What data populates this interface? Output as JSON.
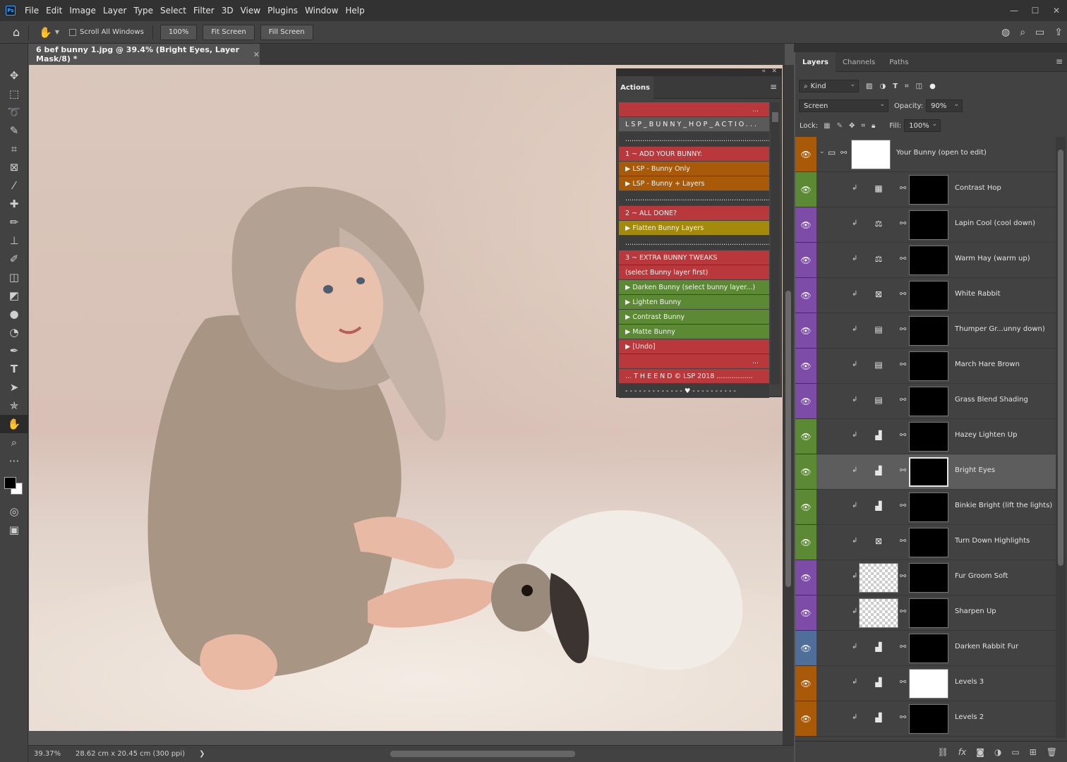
{
  "app": {
    "logo": "Ps",
    "menu": [
      "File",
      "Edit",
      "Image",
      "Layer",
      "Type",
      "Select",
      "Filter",
      "3D",
      "View",
      "Plugins",
      "Window",
      "Help"
    ],
    "window_controls": [
      "—",
      "☐",
      "✕"
    ]
  },
  "options_bar": {
    "scroll_all_windows": "Scroll All Windows",
    "zoom_value": "100%",
    "fit_screen": "Fit Screen",
    "fill_screen": "Fill Screen"
  },
  "document": {
    "tab_title": "6 bef bunny 1.jpg @ 39.4% (Bright Eyes, Layer Mask/8) *",
    "close": "✕"
  },
  "status": {
    "zoom": "39.37%",
    "doc_info": "28.62 cm x 20.45 cm (300 ppi)",
    "arrow": "❯"
  },
  "actions_panel": {
    "tab": "Actions",
    "items": [
      {
        "label": "...",
        "color": "red",
        "align": "right"
      },
      {
        "label": "LSP_BUNNY_HOP_ACTIO...",
        "color": "grey"
      },
      {
        "label": "........................................................................",
        "color": "dark"
      },
      {
        "label": "1 ~ ADD YOUR BUNNY:",
        "color": "red"
      },
      {
        "label": "▶  LSP - Bunny Only",
        "color": "orange"
      },
      {
        "label": "▶  LSP - Bunny + Layers",
        "color": "orange"
      },
      {
        "label": "........................................................................",
        "color": "dark"
      },
      {
        "label": "2 ~ ALL DONE?",
        "color": "red"
      },
      {
        "label": "▶  Flatten Bunny Layers",
        "color": "yellow"
      },
      {
        "label": "........................................................................",
        "color": "dark"
      },
      {
        "label": "3 ~ EXTRA BUNNY TWEAKS",
        "color": "red"
      },
      {
        "label": "(select Bunny layer first)",
        "color": "red"
      },
      {
        "label": "▶  Darken Bunny (select bunny layer...)",
        "color": "green"
      },
      {
        "label": "▶  Lighten Bunny",
        "color": "green"
      },
      {
        "label": "▶  Contrast Bunny",
        "color": "green"
      },
      {
        "label": "▶  Matte Bunny",
        "color": "green"
      },
      {
        "label": "▶  [Undo]",
        "color": "red"
      },
      {
        "label": "...",
        "color": "red",
        "align": "right"
      },
      {
        "label": "... T H E  E N D © LSP 2018 .................",
        "color": "red"
      },
      {
        "label": "- - - - - - - - - - - - - ♥ - - - - - - - - - -",
        "color": "dark"
      }
    ]
  },
  "layers_panel": {
    "tabs": [
      "Layers",
      "Channels",
      "Paths"
    ],
    "filter_kind": "Kind",
    "blend_mode": "Screen",
    "opacity_label": "Opacity:",
    "opacity_value": "90%",
    "lock_label": "Lock:",
    "fill_label": "Fill:",
    "fill_value": "100%",
    "layers": [
      {
        "name": "Your Bunny (open to edit)",
        "eye_color": "#a85a08",
        "type": "group",
        "adj_icon": ""
      },
      {
        "name": "Contrast Hop",
        "eye_color": "#5c8a34",
        "type": "adj",
        "adj_icon": "▦"
      },
      {
        "name": "Lapin Cool (cool down)",
        "eye_color": "#7c4ca6",
        "type": "adj",
        "adj_icon": "⚖"
      },
      {
        "name": "Warm Hay (warm up)",
        "eye_color": "#7c4ca6",
        "type": "adj",
        "adj_icon": "⚖"
      },
      {
        "name": "White Rabbit",
        "eye_color": "#7c4ca6",
        "type": "adj",
        "adj_icon": "⊠"
      },
      {
        "name": "Thumper Gr...unny down)",
        "eye_color": "#7c4ca6",
        "type": "adj",
        "adj_icon": "▤"
      },
      {
        "name": "March Hare Brown",
        "eye_color": "#7c4ca6",
        "type": "adj",
        "adj_icon": "▤"
      },
      {
        "name": "Grass Blend Shading",
        "eye_color": "#7c4ca6",
        "type": "adj",
        "adj_icon": "▤"
      },
      {
        "name": "Hazey Lighten Up",
        "eye_color": "#5c8a34",
        "type": "adj",
        "adj_icon": "▟"
      },
      {
        "name": "Bright Eyes",
        "eye_color": "#5c8a34",
        "type": "adj",
        "adj_icon": "▟"
      },
      {
        "name": "Binkie Bright (lift the lights)",
        "eye_color": "#5c8a34",
        "type": "adj",
        "adj_icon": "▟"
      },
      {
        "name": "Turn Down Highlights",
        "eye_color": "#5c8a34",
        "type": "adj",
        "adj_icon": "⊠"
      },
      {
        "name": "Fur Groom Soft",
        "eye_color": "#7c4ca6",
        "type": "pixel",
        "adj_icon": ""
      },
      {
        "name": "Sharpen Up",
        "eye_color": "#7c4ca6",
        "type": "pixel",
        "adj_icon": ""
      },
      {
        "name": "Darken Rabbit Fur",
        "eye_color": "#4f6f9a",
        "type": "adj",
        "adj_icon": "▟"
      },
      {
        "name": "Levels 3",
        "eye_color": "#a85a08",
        "type": "adj",
        "adj_icon": "▟"
      },
      {
        "name": "Levels 2",
        "eye_color": "#a85a08",
        "type": "adj",
        "adj_icon": "▟"
      }
    ],
    "selected_layer": "Bright Eyes",
    "footer_icons": [
      "link-icon",
      "fx-icon",
      "mask-icon",
      "adjustment-icon",
      "folder-icon",
      "new-layer-icon",
      "trash-icon"
    ]
  }
}
